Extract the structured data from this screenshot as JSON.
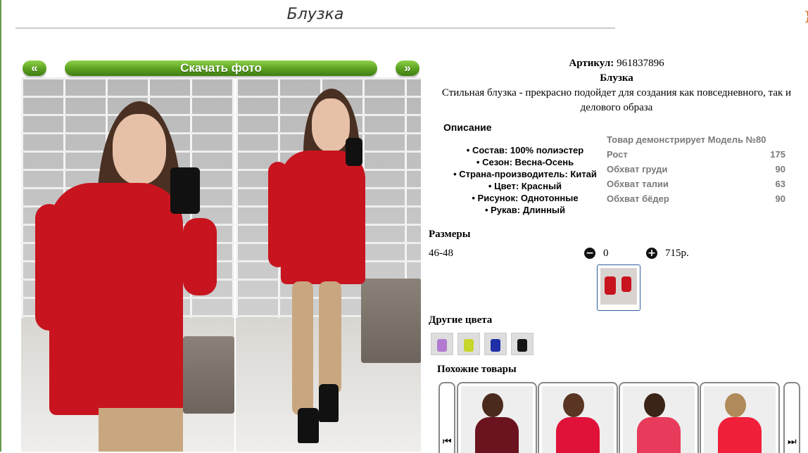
{
  "page": {
    "title": "Блузка",
    "prev_label": "«",
    "next_label": "»",
    "download_label": "Скачать фото"
  },
  "product": {
    "article_label": "Артикул:",
    "article_value": "961837896",
    "name": "Блузка",
    "tagline_line1": "Стильная блузка - прекрасно подойдет для создания как повседневного, так и",
    "tagline_line2": "делового образа"
  },
  "description": {
    "heading": "Описание",
    "features": [
      "• Состав: 100% полиэстер",
      "• Сезон: Весна-Осень",
      "• Страна-производитель: Китай",
      "• Цвет: Красный",
      "• Рисунок: Однотонные",
      "• Рукав: Длинный"
    ]
  },
  "model": {
    "heading": "Товар демонстрирует Модель №80",
    "rows": [
      {
        "label": "Рост",
        "value": "175"
      },
      {
        "label": "Обхват груди",
        "value": "90"
      },
      {
        "label": "Обхват талии",
        "value": "63"
      },
      {
        "label": "Обхват бёдер",
        "value": "90"
      }
    ]
  },
  "sizes": {
    "heading": "Размеры",
    "size_label": "46-48",
    "quantity": "0",
    "price": "715р."
  },
  "other_colors": {
    "heading": "Другие цвета",
    "swatches": [
      {
        "color": "#b27ad0",
        "icon": "lilac-blouse-thumb"
      },
      {
        "color": "#c7d62a",
        "icon": "yellow-blouse-thumb"
      },
      {
        "color": "#1f2fa8",
        "icon": "navy-blouse-thumb"
      },
      {
        "color": "#141414",
        "icon": "black-blouse-thumb"
      }
    ]
  },
  "similar": {
    "heading": "Похожие товары",
    "left_arrow": "⏮",
    "right_arrow": "⏭",
    "items": [
      {
        "color": "#6b1420",
        "icon": "burgundy-shirt-thumb"
      },
      {
        "color": "#e0123a",
        "icon": "red-shirt-thumb"
      },
      {
        "color": "#e83a5a",
        "icon": "pink-shirt-thumb"
      },
      {
        "color": "#f0203a",
        "icon": "scarlet-shirt-thumb"
      }
    ]
  },
  "colors": {
    "accent_green": "#5aa020",
    "blouse_red": "#c8141e",
    "selected_border": "#2e5d9e"
  }
}
